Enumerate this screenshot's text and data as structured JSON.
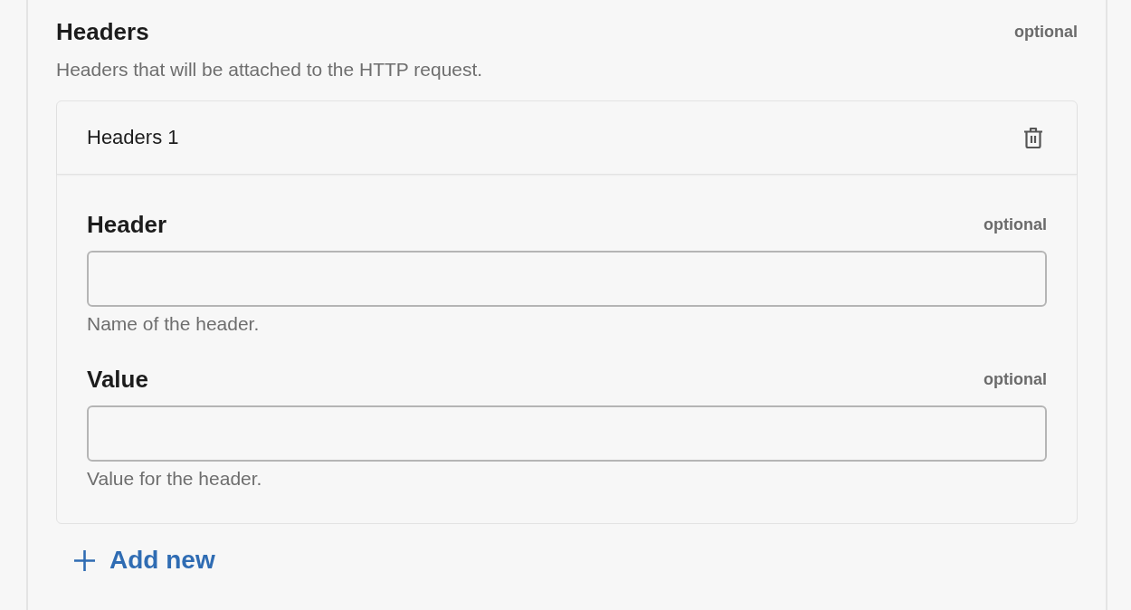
{
  "section": {
    "title": "Headers",
    "tag": "optional",
    "description": "Headers that will be attached to the HTTP request."
  },
  "items": [
    {
      "title": "Headers 1",
      "fields": [
        {
          "label": "Header",
          "tag": "optional",
          "help": "Name of the header."
        },
        {
          "label": "Value",
          "tag": "optional",
          "help": "Value for the header."
        }
      ]
    }
  ],
  "add_button": {
    "label": "Add new"
  }
}
